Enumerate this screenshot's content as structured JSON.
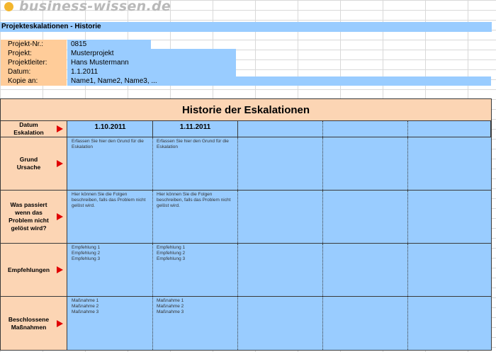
{
  "watermark": {
    "text": "business-wissen.de"
  },
  "title": "Projekteskalationen - Historie",
  "info": {
    "projekt_nr_label": "Projekt-Nr.:",
    "projekt_nr": "0815",
    "projekt_label": "Projekt:",
    "projekt": "Musterprojekt",
    "projektleiter_label": "Projektleiter:",
    "projektleiter": "Hans Mustermann",
    "datum_label": "Datum:",
    "datum": "1.1.2011",
    "kopie_label": "Kopie an:",
    "kopie": "Name1, Name2, Name3, ..."
  },
  "table": {
    "heading": "Historie der Eskalationen",
    "rows": {
      "datum": {
        "label_line1": "Datum",
        "label_line2": "Eskalation",
        "values": [
          "1.10.2011",
          "1.11.2011",
          "",
          "",
          ""
        ]
      },
      "grund": {
        "label_line1": "Grund",
        "label_line2": "Ursache",
        "values": [
          "Erfassen Sie hier den Grund für die Eskalation",
          "Erfassen Sie hier den Grund für die Eskalation",
          "",
          "",
          ""
        ]
      },
      "folgen": {
        "label_line1": "Was passiert",
        "label_line2": "wenn das",
        "label_line3": "Problem nicht",
        "label_line4": "gelöst wird?",
        "values": [
          "Hier können Sie die Folgen beschreiben, falls das Problem nicht gelöst wird.",
          "Hier können Sie die Folgen beschreiben, falls das Problem nicht gelöst wird.",
          "",
          "",
          ""
        ]
      },
      "empfehlungen": {
        "label_line1": "Empfehlungen",
        "values": [
          [
            "Empfehlung 1",
            "Empfehlung 2",
            "Empfehlung 3"
          ],
          [
            "Empfehlung 1",
            "Empfehlung 2",
            "Empfehlung 3"
          ]
        ]
      },
      "massnahmen": {
        "label_line1": "Beschlossene",
        "label_line2": "Maßnahmen",
        "values": [
          [
            "Maßnahme 1",
            "Maßnahme 2",
            "Maßnahme 3"
          ],
          [
            "Maßnahme 1",
            "Maßnahme 2",
            "Maßnahme 3"
          ]
        ]
      }
    }
  },
  "colors": {
    "blue": "#99ccff",
    "orange": "#ffcc99",
    "peach": "#fcd5b4",
    "arrow": "#e00000",
    "dot": "#f3b62d"
  }
}
